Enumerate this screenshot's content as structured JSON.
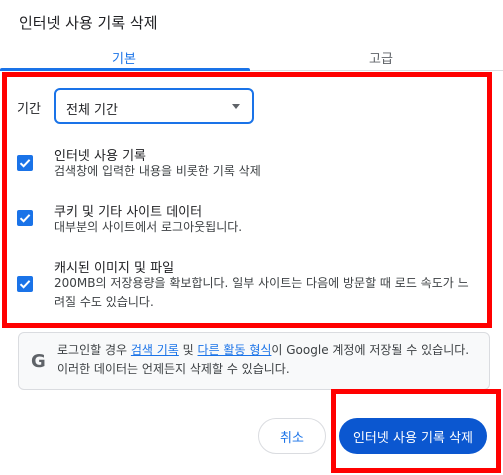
{
  "dialog": {
    "title": "인터넷 사용 기록 삭제"
  },
  "tabs": [
    {
      "label": "기본",
      "active": true
    },
    {
      "label": "고급",
      "active": false
    }
  ],
  "time_range": {
    "label": "기간",
    "selected": "전체 기간"
  },
  "options": [
    {
      "title": "인터넷 사용 기록",
      "desc": "검색창에 입력한 내용을 비롯한 기록 삭제",
      "checked": true
    },
    {
      "title": "쿠키 및 기타 사이트 데이터",
      "desc": "대부분의 사이트에서 로그아웃됩니다.",
      "checked": true
    },
    {
      "title": "캐시된 이미지 및 파일",
      "desc": "200MB의 저장용량을 확보합니다. 일부 사이트는 다음에 방문할 때 로드 속도가 느려질 수도 있습니다.",
      "checked": true
    }
  ],
  "notice": {
    "icon": "google-g-icon",
    "part1": "로그인할 경우 ",
    "link1": "검색 기록",
    "part2": " 및 ",
    "link2": "다른 활동 형식",
    "part3": "이 Google 계정에 저장될 수 있습니다. 이러한 데이터는 언제든지 삭제할 수 있습니다."
  },
  "buttons": {
    "cancel": "취소",
    "delete": "인터넷 사용 기록 삭제"
  },
  "colors": {
    "accent": "#1a73e8",
    "primary_button": "#0b57d0",
    "highlight": "#ff0000"
  }
}
